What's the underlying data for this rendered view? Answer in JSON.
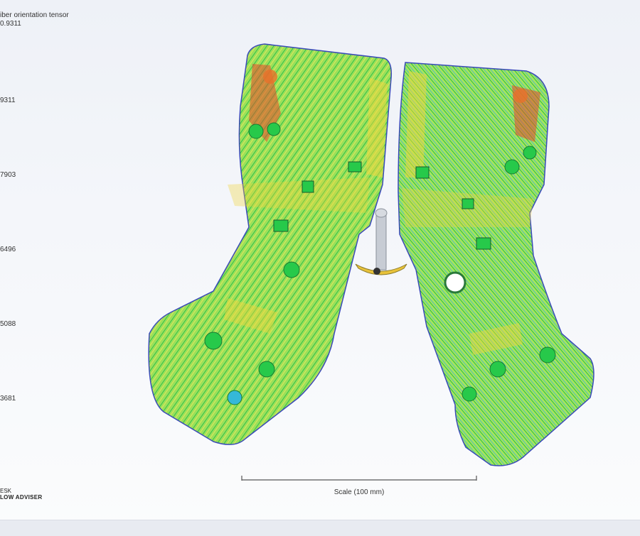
{
  "legend": {
    "title_line1": "iber orientation tensor",
    "title_line2": "0.9311",
    "ticks": [
      "9311",
      "7903",
      "6496",
      "5088",
      "3681"
    ]
  },
  "scale_bar": {
    "label": "Scale (100 mm)"
  },
  "brand": {
    "line1": "ESK",
    "line2": "LOW ADVISER"
  },
  "colors": {
    "high": "#e8452a",
    "mid_high": "#f2d53a",
    "mid": "#7be04a",
    "low": "#27c94a",
    "lowest": "#35b8d8",
    "edge": "#3a4ab8"
  }
}
